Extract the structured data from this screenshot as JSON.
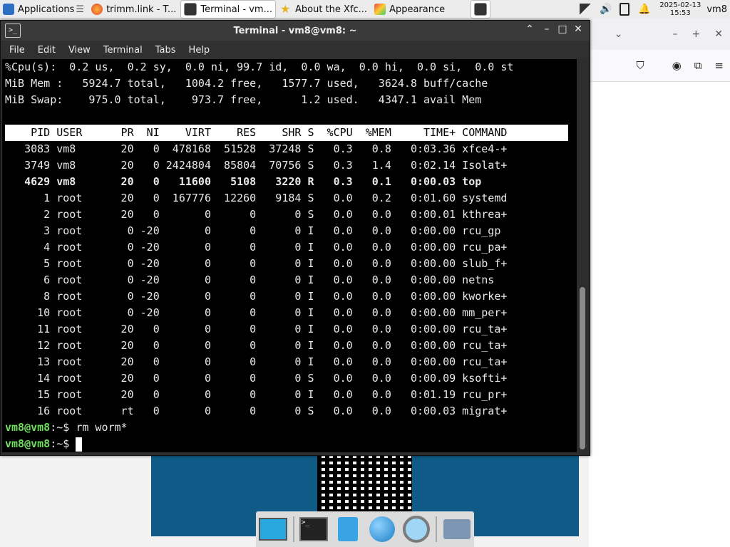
{
  "taskbar": {
    "items": [
      {
        "label": "Applications",
        "suffix": "☰"
      },
      {
        "label": "trimm.link - T..."
      },
      {
        "label": "Terminal - vm..."
      },
      {
        "label": "About the Xfc..."
      },
      {
        "label": "Appearance"
      }
    ],
    "date": "2025-02-13",
    "time": "15:53",
    "user": "vm8"
  },
  "terminal": {
    "title": "Terminal - vm8@vm8: ~",
    "menu": [
      "File",
      "Edit",
      "View",
      "Terminal",
      "Tabs",
      "Help"
    ],
    "summary": [
      "%Cpu(s):  0.2 us,  0.2 sy,  0.0 ni, 99.7 id,  0.0 wa,  0.0 hi,  0.0 si,  0.0 st",
      "MiB Mem :   5924.7 total,   1004.2 free,   1577.7 used,   3624.8 buff/cache",
      "MiB Swap:    975.0 total,    973.7 free,      1.2 used.   4347.1 avail Mem"
    ],
    "header": "    PID USER      PR  NI    VIRT    RES    SHR S  %CPU  %MEM     TIME+ COMMAND",
    "rows": [
      "   3083 vm8       20   0  478168  51528  37248 S   0.3   0.8   0:03.36 xfce4-+",
      "   3749 vm8       20   0 2424804  85804  70756 S   0.3   1.4   0:02.14 Isolat+",
      "   4629 vm8       20   0   11600   5108   3220 R   0.3   0.1   0:00.03 top",
      "      1 root      20   0  167776  12260   9184 S   0.0   0.2   0:01.60 systemd",
      "      2 root      20   0       0      0      0 S   0.0   0.0   0:00.01 kthrea+",
      "      3 root       0 -20       0      0      0 I   0.0   0.0   0:00.00 rcu_gp",
      "      4 root       0 -20       0      0      0 I   0.0   0.0   0:00.00 rcu_pa+",
      "      5 root       0 -20       0      0      0 I   0.0   0.0   0:00.00 slub_f+",
      "      6 root       0 -20       0      0      0 I   0.0   0.0   0:00.00 netns",
      "      8 root       0 -20       0      0      0 I   0.0   0.0   0:00.00 kworke+",
      "     10 root       0 -20       0      0      0 I   0.0   0.0   0:00.00 mm_per+",
      "     11 root      20   0       0      0      0 I   0.0   0.0   0:00.00 rcu_ta+",
      "     12 root      20   0       0      0      0 I   0.0   0.0   0:00.00 rcu_ta+",
      "     13 root      20   0       0      0      0 I   0.0   0.0   0:00.00 rcu_ta+",
      "     14 root      20   0       0      0      0 S   0.0   0.0   0:00.09 ksofti+",
      "     15 root      20   0       0      0      0 I   0.0   0.0   0:01.19 rcu_pr+",
      "     16 root      rt   0       0      0      0 S   0.0   0.0   0:00.03 migrat+"
    ],
    "prompt_user": "vm8@vm8",
    "prompt_path": ":~$ ",
    "commands": [
      "rm worm*",
      ""
    ]
  }
}
